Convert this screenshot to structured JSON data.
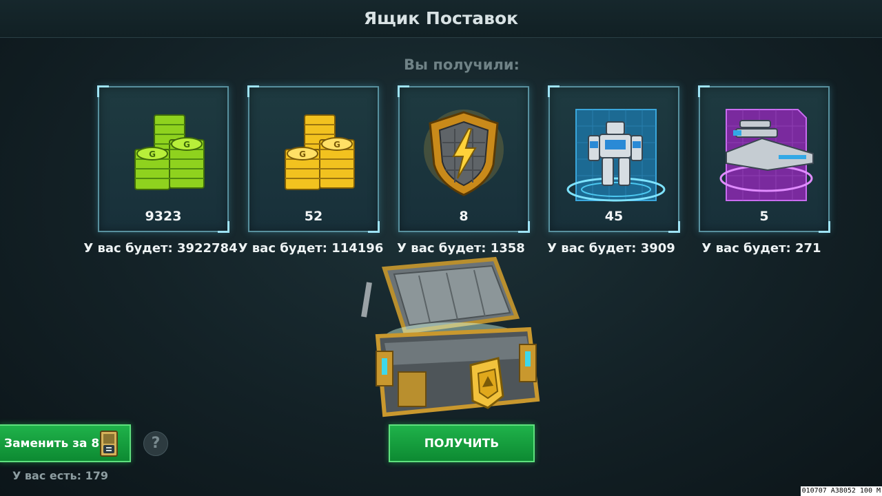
{
  "header": {
    "title": "Ящик Поставок"
  },
  "rewards": {
    "label": "Вы получили:",
    "items": [
      {
        "icon": "green-credits-icon",
        "count": "9323",
        "will_have": "У вас будет: 3922784"
      },
      {
        "icon": "gold-credits-icon",
        "count": "52",
        "will_have": "У вас будет: 114196"
      },
      {
        "icon": "energy-shield-badge-icon",
        "count": "8",
        "will_have": "У вас будет: 1358"
      },
      {
        "icon": "robot-card-icon",
        "count": "45",
        "will_have": "У вас будет: 3909"
      },
      {
        "icon": "weapon-card-icon",
        "count": "5",
        "will_have": "У вас будет: 271"
      }
    ]
  },
  "actions": {
    "replace_label": "Заменить за 8",
    "help_label": "?",
    "have_label": "У вас есть: 179",
    "get_label": "ПОЛУЧИТЬ"
  },
  "overlay": {
    "debug_text": "010707 A38052 100 M"
  },
  "colors": {
    "accent_green": "#1fb24a",
    "card_border": "#58909e",
    "background": "#132126"
  }
}
